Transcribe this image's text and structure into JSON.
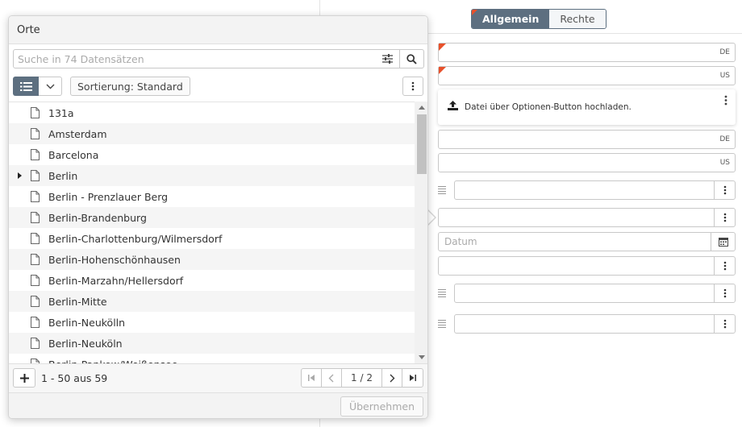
{
  "tabs": {
    "general": "Allgemein",
    "rights": "Rechte"
  },
  "form": {
    "lang_de": "DE",
    "lang_us": "US",
    "upload_hint": "Datei über Optionen-Button hochladen.",
    "date_placeholder": "Datum"
  },
  "popup": {
    "title": "Orte",
    "search_placeholder": "Suche in 74 Datensätzen",
    "sort_label": "Sortierung: Standard",
    "items": [
      {
        "label": "131a",
        "expandable": false
      },
      {
        "label": "Amsterdam",
        "expandable": false
      },
      {
        "label": "Barcelona",
        "expandable": false
      },
      {
        "label": "Berlin",
        "expandable": true
      },
      {
        "label": "Berlin - Prenzlauer Berg",
        "expandable": false
      },
      {
        "label": "Berlin-Brandenburg",
        "expandable": false
      },
      {
        "label": "Berlin-Charlottenburg/Wilmersdorf",
        "expandable": false
      },
      {
        "label": "Berlin-Hohenschönhausen",
        "expandable": false
      },
      {
        "label": "Berlin-Marzahn/Hellersdorf",
        "expandable": false
      },
      {
        "label": "Berlin-Mitte",
        "expandable": false
      },
      {
        "label": "Berlin-Neukölln",
        "expandable": false
      },
      {
        "label": "Berlin-Neuköln",
        "expandable": false
      },
      {
        "label": "Berlin-Pankow/Weißensee",
        "expandable": false
      }
    ],
    "record_count": "1 - 50 aus 59",
    "page_indicator": "1 / 2",
    "apply_label": "Übernehmen"
  },
  "colors": {
    "accent": "#5d6f80",
    "required": "#e8502a"
  }
}
